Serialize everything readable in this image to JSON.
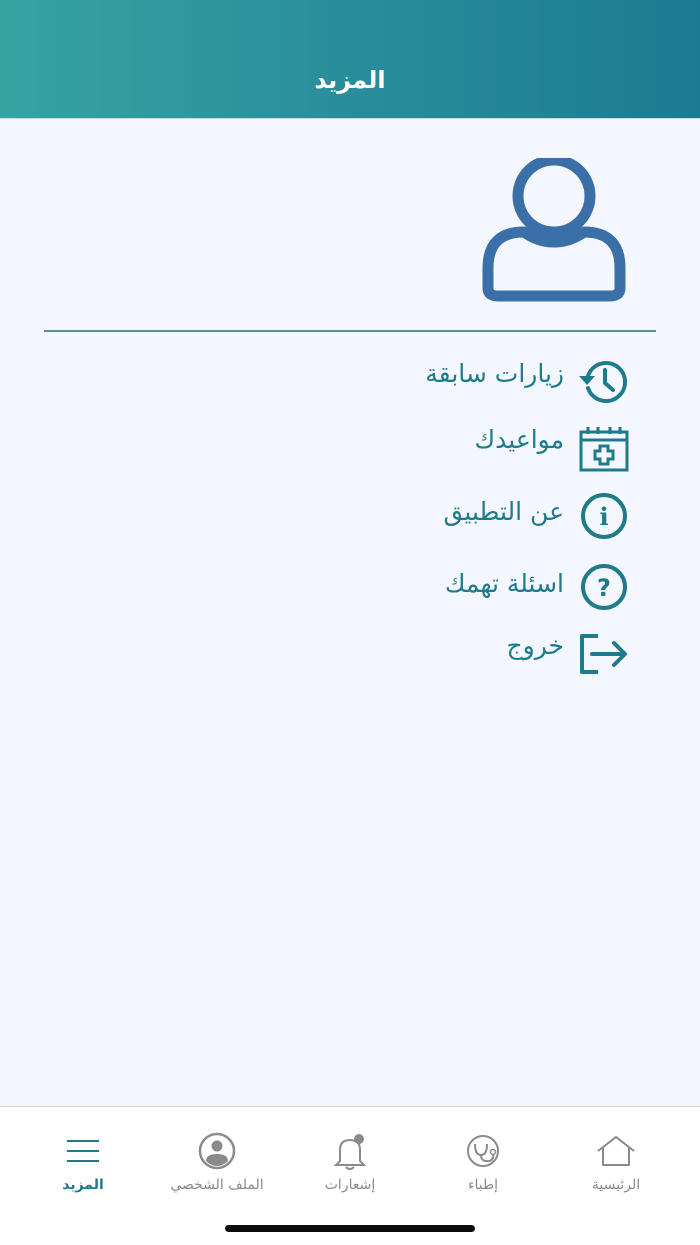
{
  "header": {
    "title": "المزيد"
  },
  "menu": {
    "items": [
      {
        "label": "زيارات سابقة",
        "icon": "history-icon"
      },
      {
        "label": "مواعيدك",
        "icon": "calendar-add-icon"
      },
      {
        "label": "عن التطبيق",
        "icon": "info-icon"
      },
      {
        "label": "اسئلة تهمك",
        "icon": "question-icon"
      },
      {
        "label": "خروج",
        "icon": "logout-icon"
      }
    ]
  },
  "tabbar": {
    "active": "more",
    "tabs": [
      {
        "id": "more",
        "label": "المزيد",
        "icon": "menu-icon"
      },
      {
        "id": "profile",
        "label": "الملف الشخصي",
        "icon": "profile-icon"
      },
      {
        "id": "notifications",
        "label": "إشعارات",
        "icon": "bell-icon"
      },
      {
        "id": "doctors",
        "label": "إطباء",
        "icon": "stethoscope-icon"
      },
      {
        "id": "home",
        "label": "الرئيسية",
        "icon": "home-icon"
      }
    ]
  },
  "colors": {
    "header_gradient_start": "#37a3a1",
    "header_gradient_end": "#1c7b93",
    "accent": "#1f7a8c",
    "avatar": "#3a6fa8",
    "background": "#f4f8fe"
  }
}
